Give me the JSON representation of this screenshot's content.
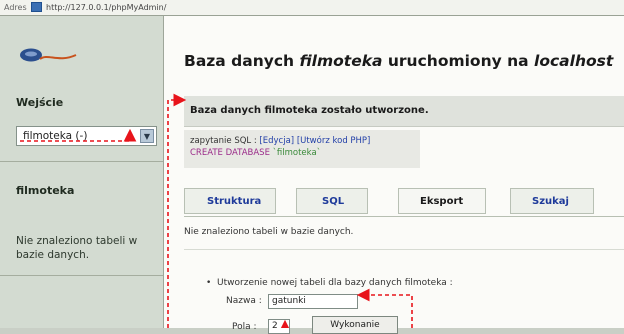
{
  "address_bar": {
    "label": "Adres",
    "url": "http://127.0.0.1/phpMyAdmin/"
  },
  "sidebar": {
    "logo_alt": "phpMyAdmin",
    "login_heading": "Wejście",
    "db_select_value": "filmoteka (-)",
    "db_name": "filmoteka",
    "no_tables": "Nie znaleziono tabeli w bazie danych."
  },
  "main": {
    "title_pre": "Baza danych ",
    "title_db": "filmoteka",
    "title_mid": " uruchomiony na ",
    "title_host": "localhost",
    "message": "Baza danych filmoteka zostało utworzone.",
    "sql_label": "zapytanie SQL : ",
    "link_edit": "[Edycja]",
    "link_php": "[Utwórz kod PHP]",
    "sql_keyword": "CREATE DATABASE",
    "sql_identifier": "`filmoteka`",
    "tabs": [
      "Struktura",
      "SQL",
      "Eksport",
      "Szukaj"
    ],
    "no_tables_main": "Nie znaleziono tabeli w bazie danych.",
    "create_label": "Utworzenie nowej tabeli dla bazy danych filmoteka :",
    "name_label": "Nazwa :",
    "name_value": "gatunki",
    "fields_label": "Pola :",
    "fields_value": "2",
    "submit_label": "Wykonanie"
  },
  "colors": {
    "annotation": "#e8141b",
    "link": "#2340a8",
    "sql_keyword": "#9b2c8a"
  }
}
